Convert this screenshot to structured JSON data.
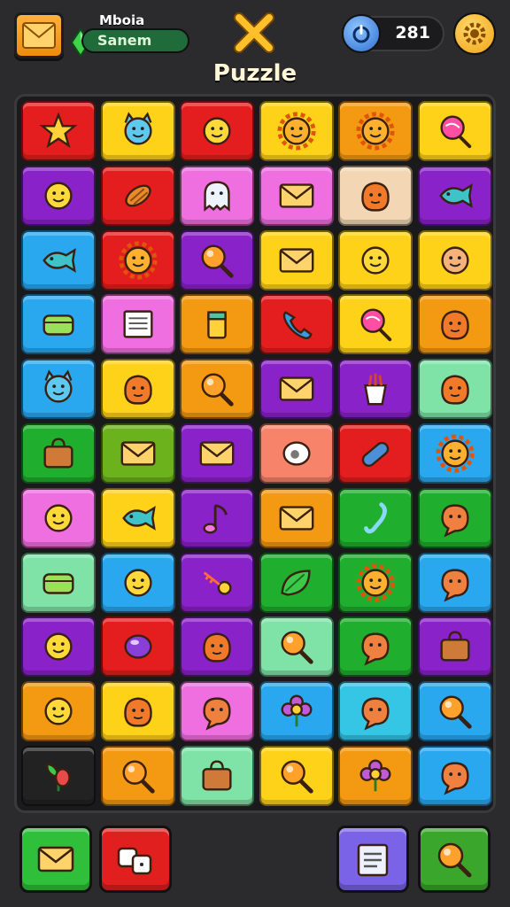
{
  "header": {
    "player_label": "Mboia",
    "player_name": "Sanem",
    "score": "281",
    "title": "Puzzle"
  },
  "colors": {
    "red": "#e41e1e",
    "yellow": "#ffd21a",
    "orange": "#f39a12",
    "purple": "#8a22c9",
    "pink": "#ef6fe0",
    "sky": "#2aa8ef",
    "green": "#1fae2e",
    "mint": "#7fe3a8",
    "peach": "#f3d7b5",
    "olive": "#6bb21c",
    "salmon": "#f7836a",
    "dark": "#222222",
    "teal": "#35c6e6"
  },
  "board": {
    "rows": [
      [
        {
          "c": "red",
          "i": "star-icon"
        },
        {
          "c": "yellow",
          "i": "cat-face-icon"
        },
        {
          "c": "red",
          "i": "smiley-icon"
        },
        {
          "c": "yellow",
          "i": "sun-face-icon"
        },
        {
          "c": "orange",
          "i": "sun-face-icon"
        },
        {
          "c": "yellow",
          "i": "lollipop-icon"
        }
      ],
      [
        {
          "c": "purple",
          "i": "smiley-icon"
        },
        {
          "c": "red",
          "i": "food-icon"
        },
        {
          "c": "pink",
          "i": "ghost-icon"
        },
        {
          "c": "pink",
          "i": "envelope-icon"
        },
        {
          "c": "peach",
          "i": "blob-face-icon"
        },
        {
          "c": "purple",
          "i": "fish-icon"
        }
      ],
      [
        {
          "c": "sky",
          "i": "fish-icon"
        },
        {
          "c": "red",
          "i": "sun-face-icon"
        },
        {
          "c": "purple",
          "i": "magnifier-icon"
        },
        {
          "c": "yellow",
          "i": "envelope-icon"
        },
        {
          "c": "yellow",
          "i": "smiley-icon"
        },
        {
          "c": "yellow",
          "i": "person-face-icon"
        }
      ],
      [
        {
          "c": "sky",
          "i": "box-icon"
        },
        {
          "c": "pink",
          "i": "document-icon"
        },
        {
          "c": "orange",
          "i": "jar-icon"
        },
        {
          "c": "red",
          "i": "phone-icon"
        },
        {
          "c": "yellow",
          "i": "lollipop-icon"
        },
        {
          "c": "orange",
          "i": "blob-face-icon"
        }
      ],
      [
        {
          "c": "sky",
          "i": "cat-face-icon"
        },
        {
          "c": "yellow",
          "i": "blob-face-icon"
        },
        {
          "c": "orange",
          "i": "magnifier-icon"
        },
        {
          "c": "purple",
          "i": "envelope-icon"
        },
        {
          "c": "purple",
          "i": "popcorn-icon"
        },
        {
          "c": "mint",
          "i": "blob-face-icon"
        }
      ],
      [
        {
          "c": "green",
          "i": "bag-icon"
        },
        {
          "c": "olive",
          "i": "envelope-icon"
        },
        {
          "c": "purple",
          "i": "envelope-icon"
        },
        {
          "c": "salmon",
          "i": "eye-icon"
        },
        {
          "c": "red",
          "i": "bandage-icon"
        },
        {
          "c": "sky",
          "i": "sun-face-icon"
        }
      ],
      [
        {
          "c": "pink",
          "i": "smiley-icon"
        },
        {
          "c": "yellow",
          "i": "fish-icon"
        },
        {
          "c": "purple",
          "i": "music-note-icon"
        },
        {
          "c": "orange",
          "i": "envelope-icon"
        },
        {
          "c": "green",
          "i": "hook-icon"
        },
        {
          "c": "green",
          "i": "speech-face-icon"
        }
      ],
      [
        {
          "c": "mint",
          "i": "box-icon"
        },
        {
          "c": "sky",
          "i": "smiley-icon"
        },
        {
          "c": "purple",
          "i": "key-icon"
        },
        {
          "c": "green",
          "i": "leaf-icon"
        },
        {
          "c": "green",
          "i": "sun-face-icon"
        },
        {
          "c": "sky",
          "i": "speech-face-icon"
        }
      ],
      [
        {
          "c": "purple",
          "i": "smiley-icon"
        },
        {
          "c": "red",
          "i": "gem-icon"
        },
        {
          "c": "purple",
          "i": "blob-face-icon"
        },
        {
          "c": "mint",
          "i": "magnifier-icon"
        },
        {
          "c": "green",
          "i": "speech-face-icon"
        },
        {
          "c": "purple",
          "i": "bag-icon"
        }
      ],
      [
        {
          "c": "orange",
          "i": "smiley-icon"
        },
        {
          "c": "yellow",
          "i": "blob-face-icon"
        },
        {
          "c": "pink",
          "i": "speech-face-icon"
        },
        {
          "c": "sky",
          "i": "flower-icon"
        },
        {
          "c": "teal",
          "i": "speech-face-icon"
        },
        {
          "c": "sky",
          "i": "magnifier-icon"
        }
      ],
      [
        {
          "c": "dark",
          "i": "plant-icon"
        },
        {
          "c": "orange",
          "i": "magnifier-icon"
        },
        {
          "c": "mint",
          "i": "bag-icon"
        },
        {
          "c": "yellow",
          "i": "magnifier-icon"
        },
        {
          "c": "orange",
          "i": "flower-icon"
        },
        {
          "c": "sky",
          "i": "speech-face-icon"
        }
      ]
    ]
  },
  "footer": {
    "buttons": [
      {
        "name": "mail-button",
        "icon": "envelope-icon",
        "color": "#2fbf3a"
      },
      {
        "name": "hint-button",
        "icon": "dice-icon",
        "color": "#e21f1f"
      },
      {
        "name": "book-button",
        "icon": "book-icon",
        "color": "#7a63e6"
      },
      {
        "name": "search-button",
        "icon": "magnifier-icon",
        "color": "#3aa62c"
      }
    ]
  }
}
